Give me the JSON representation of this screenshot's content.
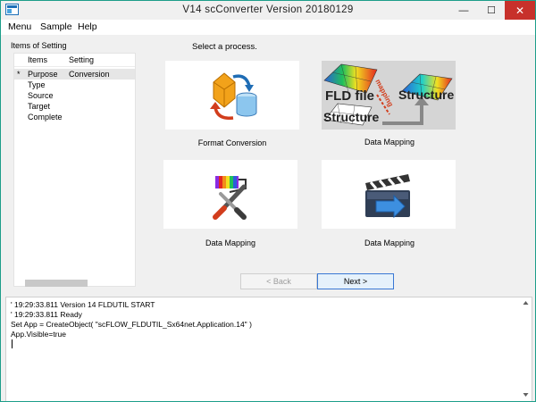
{
  "window": {
    "title": "V14 scConverter Version 20180129",
    "min": "—",
    "max": "☐",
    "close": "✕"
  },
  "menu": [
    "Menu",
    "Sample",
    "Help"
  ],
  "left": {
    "title": "Items of Setting",
    "col_items": "Items",
    "col_setting": "Setting",
    "rows": [
      {
        "marker": "*",
        "item": "Purpose",
        "setting": "Conversion"
      },
      {
        "marker": "",
        "item": "Type",
        "setting": ""
      },
      {
        "marker": "",
        "item": "Source",
        "setting": ""
      },
      {
        "marker": "",
        "item": "Target",
        "setting": ""
      },
      {
        "marker": "",
        "item": "Complete",
        "setting": ""
      }
    ]
  },
  "main": {
    "prompt": "Select a process.",
    "cards": [
      {
        "label": "Format Conversion",
        "icon": "format-conversion-icon"
      },
      {
        "label": "Data Mapping",
        "icon": "fld-mapping-image",
        "img_fld": "FLD file",
        "img_mapping": "mapping",
        "img_structure1": "Structure",
        "img_structure2": "Structure"
      },
      {
        "label": "Data Mapping",
        "icon": "tools-icon"
      },
      {
        "label": "Data Mapping",
        "icon": "clapperboard-icon"
      }
    ],
    "back": "< Back",
    "next": "Next >"
  },
  "log": [
    "' 19:29:33.811 Version 14 FLDUTIL START",
    "' 19:29:33.811 Ready",
    "Set App = CreateObject( \"scFLOW_FLDUTIL_Sx64net.Application.14\" )",
    "App.Visible=true"
  ]
}
